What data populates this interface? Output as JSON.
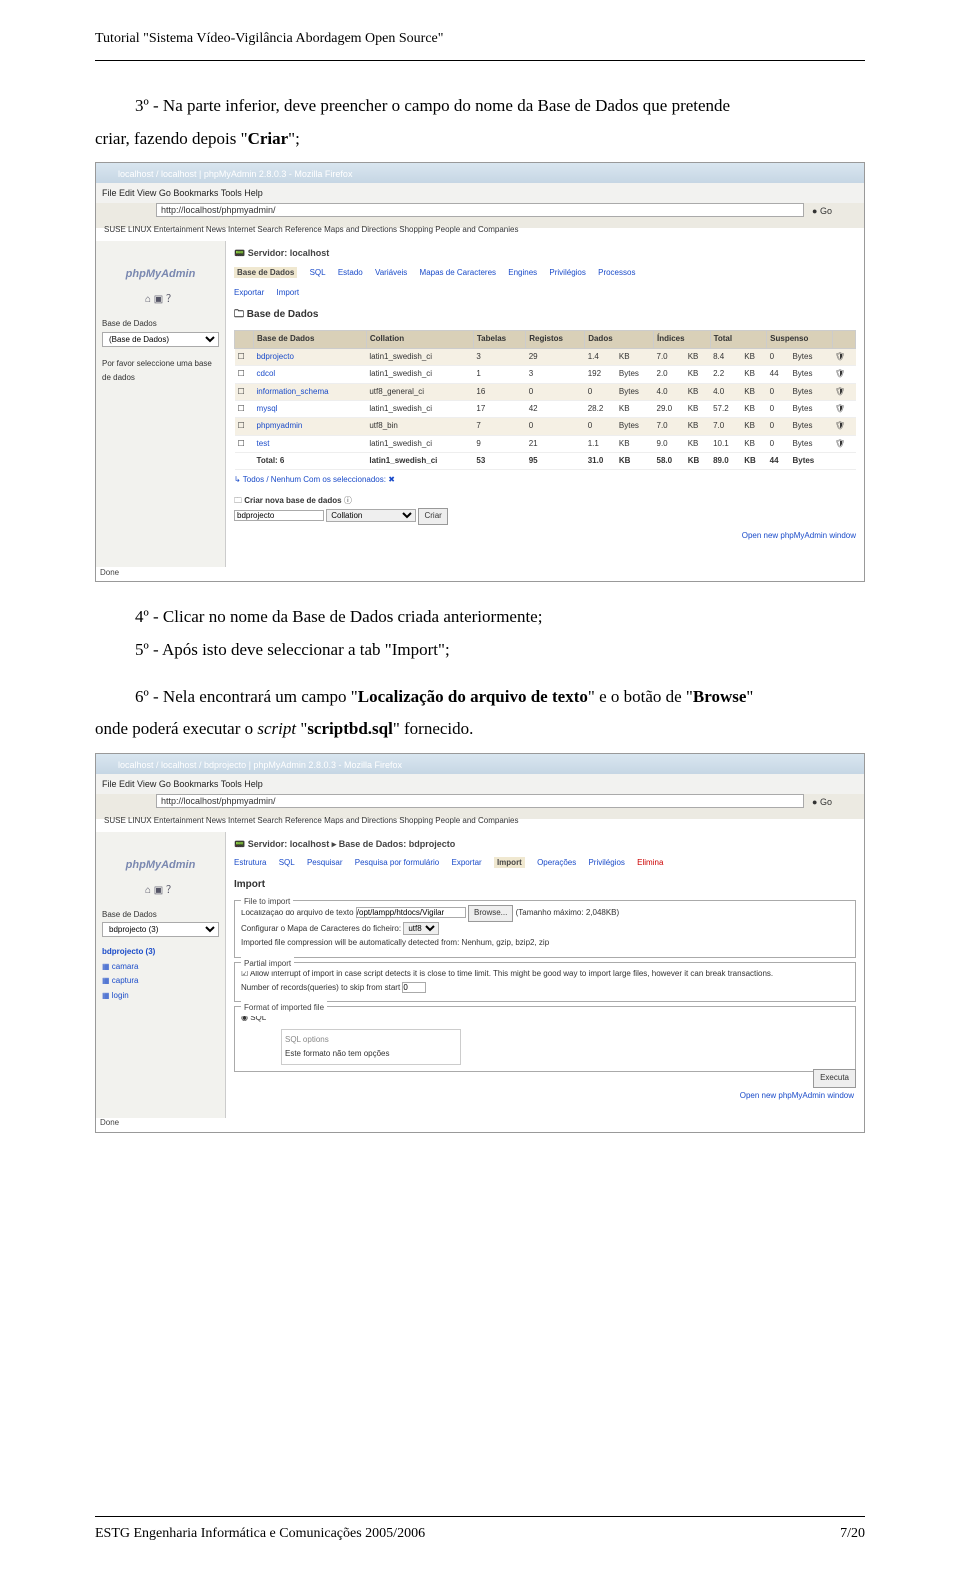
{
  "header": "Tutorial \"Sistema Vídeo-Vigilância Abordagem Open Source\"",
  "p1_a": "3º - Na parte inferior, deve preencher o campo do nome da Base de Dados que pretende",
  "p1_b": "criar, fazendo depois \"",
  "p1_c": "Criar",
  "p1_d": "\";",
  "p2_a": "4º - Clicar no nome da Base de Dados criada anteriormente;",
  "p3_a": "5º - Após isto deve seleccionar a tab \"Import\";",
  "p4_a": "6º - Nela encontrará um campo \"",
  "p4_b": "Localização do arquivo de texto",
  "p4_c": "\"",
  "p4_d": "e o botão de \"",
  "p4_e": "Browse",
  "p4_f": "\"",
  "p5_a": "onde poderá executar o ",
  "p5_b": "script",
  "p5_c": " \"",
  "p5_d": "scriptbd.sql",
  "p5_e": "\" fornecido.",
  "footer_left": "ESTG Engenharia Informática e Comunicações 2005/2006",
  "footer_right": "7/20",
  "s1": {
    "title": "localhost / localhost | phpMyAdmin 2.8.0.3 - Mozilla Firefox",
    "menu": "File   Edit   View   Go   Bookmarks   Tools   Help",
    "url": "http://localhost/phpmyadmin/",
    "go": "Go",
    "bookmarks": "SUSE LINUX   Entertainment   News   Internet Search   Reference   Maps and Directions   Shopping   People and Companies",
    "logo": "phpMyAdmin",
    "sb_label": "Base de Dados",
    "sb_sel": "(Base de Dados)",
    "sb_help": "Por favor seleccione uma base de dados",
    "srv": "Servidor: localhost",
    "tabs": [
      "Base de Dados",
      "SQL",
      "Estado",
      "Variáveis",
      "Mapas de Caracteres",
      "Engines",
      "Privilégios",
      "Processos"
    ],
    "tabs2": [
      "Exportar",
      "Import"
    ],
    "h_bd": "Base de Dados",
    "cols": [
      "Base de Dados",
      "Collation",
      "Tabelas",
      "Registos",
      "Dados",
      "",
      "Índices",
      "",
      "Total",
      "",
      "Suspenso",
      ""
    ],
    "rows": [
      [
        "bdprojecto",
        "latin1_swedish_ci",
        "3",
        "29",
        "1.4",
        "KB",
        "7.0",
        "KB",
        "8.4",
        "KB",
        "0",
        "Bytes"
      ],
      [
        "cdcol",
        "latin1_swedish_ci",
        "1",
        "3",
        "192",
        "Bytes",
        "2.0",
        "KB",
        "2.2",
        "KB",
        "44",
        "Bytes"
      ],
      [
        "information_schema",
        "utf8_general_ci",
        "16",
        "0",
        "0",
        "Bytes",
        "4.0",
        "KB",
        "4.0",
        "KB",
        "0",
        "Bytes"
      ],
      [
        "mysql",
        "latin1_swedish_ci",
        "17",
        "42",
        "28.2",
        "KB",
        "29.0",
        "KB",
        "57.2",
        "KB",
        "0",
        "Bytes"
      ],
      [
        "phpmyadmin",
        "utf8_bin",
        "7",
        "0",
        "0",
        "Bytes",
        "7.0",
        "KB",
        "7.0",
        "KB",
        "0",
        "Bytes"
      ],
      [
        "test",
        "latin1_swedish_ci",
        "9",
        "21",
        "1.1",
        "KB",
        "9.0",
        "KB",
        "10.1",
        "KB",
        "0",
        "Bytes"
      ]
    ],
    "total_row": [
      "Total: 6",
      "latin1_swedish_ci",
      "53",
      "95",
      "31.0",
      "KB",
      "58.0",
      "KB",
      "89.0",
      "KB",
      "44",
      "Bytes"
    ],
    "sel_line": "Todos / Nenhum Com os seleccionados:",
    "create_h": "Criar nova base de dados",
    "create_val": "bdprojecto",
    "create_coll": "Collation",
    "create_btn": "Criar",
    "open_link": "Open new phpMyAdmin window",
    "status": "Done"
  },
  "s2": {
    "title": "localhost / localhost / bdprojecto   | phpMyAdmin 2.8.0.3 - Mozilla Firefox",
    "menu": "File   Edit   View   Go   Bookmarks   Tools   Help",
    "url": "http://localhost/phpmyadmin/",
    "go": "Go",
    "bookmarks": "SUSE LINUX   Entertainment   News   Internet Search   Reference   Maps and Directions   Shopping   People and Companies",
    "logo": "phpMyAdmin",
    "sb_label": "Base de Dados",
    "sb_sel": "bdprojecto (3)",
    "sb_list_name": "bdprojecto (3)",
    "sb_items": [
      "camara",
      "captura",
      "login"
    ],
    "srv": "Servidor: localhost  ▸  Base de Dados: bdprojecto",
    "tabs": [
      "Estrutura",
      "SQL",
      "Pesquisar",
      "Pesquisa por formulário",
      "Exportar",
      "Import",
      "Operações",
      "Privilégios",
      "Elimina"
    ],
    "h_import": "Import",
    "g1_legend": "File to import",
    "g1_loc": "Localização do arquivo de texto",
    "g1_path": "/opt/lampp/htdocs/Vigilar",
    "g1_browse": "Browse...",
    "g1_size": "(Tamanho máximo: 2,048KB)",
    "g1_char": "Configurar o Mapa de Caracteres do ficheiro:",
    "g1_char_val": "utf8",
    "g1_comp": "Imported file compression will be automatically detected from: Nenhum, gzip, bzip2, zip",
    "g2_legend": "Partial import",
    "g2_chk": "Allow interrupt of import in case script detects it is close to time limit. This might be good way to import large files, however it can break transactions.",
    "g2_skip": "Number of records(queries) to skip from start",
    "g2_skip_val": "0",
    "g3_legend": "Format of imported file",
    "g3_radio": "SQL",
    "g3_opt": "SQL options",
    "g3_note": "Este formato não tem opções",
    "exec": "Executa",
    "open_link": "Open new phpMyAdmin window",
    "status": "Done"
  }
}
